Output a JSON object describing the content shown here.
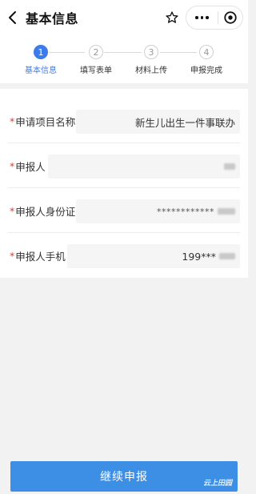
{
  "header": {
    "title": "基本信息"
  },
  "steps": [
    {
      "number": "1",
      "label": "基本信息",
      "active": true
    },
    {
      "number": "2",
      "label": "填写表单",
      "active": false
    },
    {
      "number": "3",
      "label": "材料上传",
      "active": false
    },
    {
      "number": "4",
      "label": "申报完成",
      "active": false
    }
  ],
  "form": {
    "required_mark": "*",
    "fields": [
      {
        "label": "申请项目名称",
        "value": "新生儿出生一件事联办"
      },
      {
        "label": "申报人",
        "value": ""
      },
      {
        "label": "申报人身份证",
        "value": "************"
      },
      {
        "label": "申报人手机",
        "value": "199***"
      }
    ]
  },
  "footer": {
    "submit_label": "继续申报",
    "watermark": "云上田园"
  },
  "colors": {
    "accent": "#3b7ce8",
    "button": "#3d8fe6",
    "required": "#d0443a"
  },
  "icons": [
    "back-icon",
    "star-icon",
    "more-icon",
    "close-circle-icon"
  ]
}
